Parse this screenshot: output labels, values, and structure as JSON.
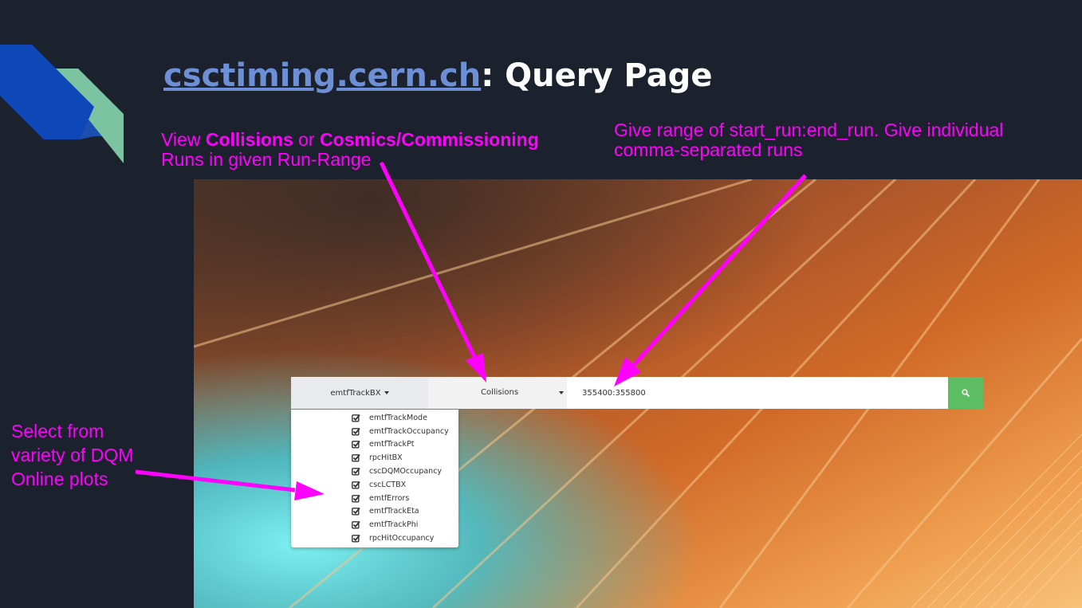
{
  "slide": {
    "title_link": "csctiming.cern.ch",
    "title_rest": ": Query Page"
  },
  "annotations": {
    "run_type": {
      "part1": "View ",
      "bold1": "Collisions",
      "part2": " or ",
      "bold2": "Cosmics/Commissioning",
      "line2": "Runs in given Run-Range"
    },
    "run_range": {
      "line1": "Give range of start_run:end_run. Give individual",
      "line2": "comma-separated runs"
    },
    "plots": {
      "line1": "Select from",
      "line2": "variety of DQM",
      "line3": "Online plots"
    }
  },
  "searchbar": {
    "plot_dropdown_label": "emtfTrackBX",
    "run_type_value": "Collisions",
    "run_range_value": "355400:355800",
    "search_icon": "search-icon"
  },
  "plot_options": [
    {
      "label": "emtfTrackMode",
      "checked": true
    },
    {
      "label": "emtfTrackOccupancy",
      "checked": true
    },
    {
      "label": "emtfTrackPt",
      "checked": true
    },
    {
      "label": "rpcHitBX",
      "checked": true
    },
    {
      "label": "cscDQMOccupancy",
      "checked": true
    },
    {
      "label": "cscLCTBX",
      "checked": true
    },
    {
      "label": "emtfErrors",
      "checked": true
    },
    {
      "label": "emtfTrackEta",
      "checked": true
    },
    {
      "label": "emtfTrackPhi",
      "checked": true
    },
    {
      "label": "rpcHitOccupancy",
      "checked": true
    }
  ],
  "colors": {
    "background": "#1c222d",
    "annotation": "#ff00ff",
    "title_link": "#6d8fd6",
    "search_button": "#5cbd62"
  }
}
